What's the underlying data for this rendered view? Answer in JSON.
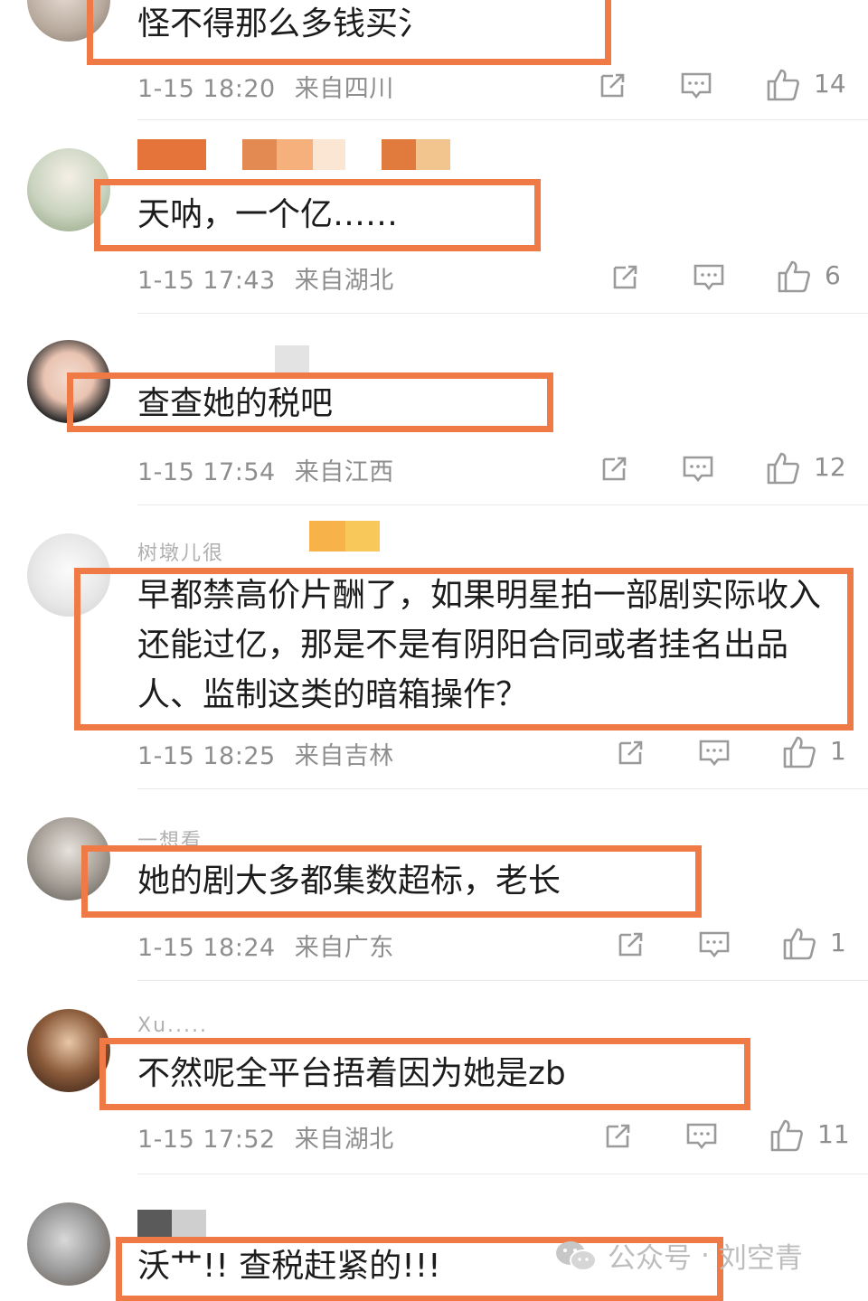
{
  "comments": [
    {
      "text_lines": [
        "怪不得那么多钱买氵"
      ],
      "time": "1-15 18:20",
      "location": "来自四川",
      "likes": "14",
      "username": ""
    },
    {
      "text_lines": [
        "天呐，一个亿……"
      ],
      "time": "1-15 17:43",
      "location": "来自湖北",
      "likes": "6",
      "username": ""
    },
    {
      "text_lines": [
        "查查她的税吧"
      ],
      "time": "1-15 17:54",
      "location": "来自江西",
      "likes": "12",
      "username": ""
    },
    {
      "text_lines": [
        "早都禁高价片酬了，如果明星拍一部剧实际收入",
        "还能过亿，那是不是有阴阳合同或者挂名出品",
        "人、监制这类的暗箱操作？"
      ],
      "time": "1-15 18:25",
      "location": "来自吉林",
      "likes": "1",
      "username": "树墩儿很"
    },
    {
      "text_lines": [
        "她的剧大多都集数超标，老长"
      ],
      "time": "1-15 18:24",
      "location": "来自广东",
      "likes": "1",
      "username": "一想看"
    },
    {
      "text_lines": [
        "不然呢全平台捂着因为她是zb"
      ],
      "time": "1-15 17:52",
      "location": "来自湖北",
      "likes": "11",
      "username": "Xu....."
    },
    {
      "text_lines": [
        "沃艹!! 查税赶紧的!!!"
      ],
      "time": "",
      "location": "",
      "likes": "",
      "username": ""
    }
  ],
  "watermark": {
    "label": "公众号",
    "dot": "·",
    "author": "刘空青"
  },
  "colors": {
    "highlight": "#f07a45",
    "meta": "#8e8e8e",
    "divider": "#eaeaea"
  },
  "icons": [
    "share-icon",
    "comment-icon",
    "like-icon",
    "wechat-icon"
  ]
}
